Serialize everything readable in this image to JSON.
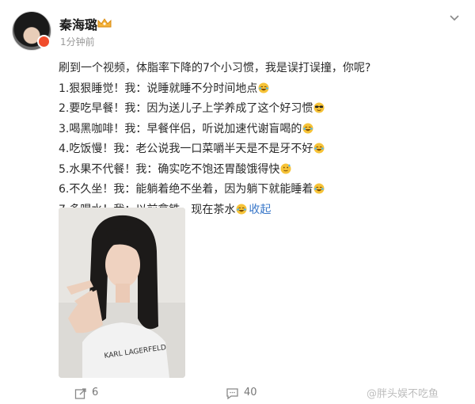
{
  "header": {
    "username": "秦海璐",
    "badge_icon": "crown-badge-icon",
    "timestamp": "1分钟前",
    "menu_icon": "chevron-down-icon"
  },
  "post": {
    "lines": [
      {
        "text": "刷到一个视频，体脂率下降的7个小习惯，我是误打误撞，你呢?",
        "emoji": ""
      },
      {
        "text": "1.狠狠睡觉！我：说睡就睡不分时间地点",
        "emoji": "laugh-cry-emoji-icon"
      },
      {
        "text": "2.要吃早餐！我：因为送儿子上学养成了这个好习惯",
        "emoji": "sunglasses-emoji-icon"
      },
      {
        "text": "3.喝黑咖啡！我：早餐伴侣，听说加速代谢盲喝的",
        "emoji": "laugh-cry-emoji-icon"
      },
      {
        "text": "4.吃饭慢！我：老公说我一口菜嚼半天是不是牙不好",
        "emoji": "laugh-cry-emoji-icon"
      },
      {
        "text": "5.水果不代餐！我：确实吃不饱还胃酸饿得快",
        "emoji": "awkward-smile-emoji-icon"
      },
      {
        "text": "6.不久坐！我：能躺着绝不坐着，因为躺下就能睡着",
        "emoji": "laugh-cry-emoji-icon"
      },
      {
        "text": "7.多喝水！我：以前拿铁，现在茶水",
        "emoji": "laugh-cry-emoji-icon"
      }
    ],
    "collapse_label": "收起"
  },
  "footer": {
    "repost_count": "6",
    "comment_count": "40",
    "watermark": "@胖头娱不吃鱼"
  },
  "colors": {
    "link": "#3a78c9",
    "emoji": "#f6c338",
    "avatar_badge": "#f04c2b"
  }
}
